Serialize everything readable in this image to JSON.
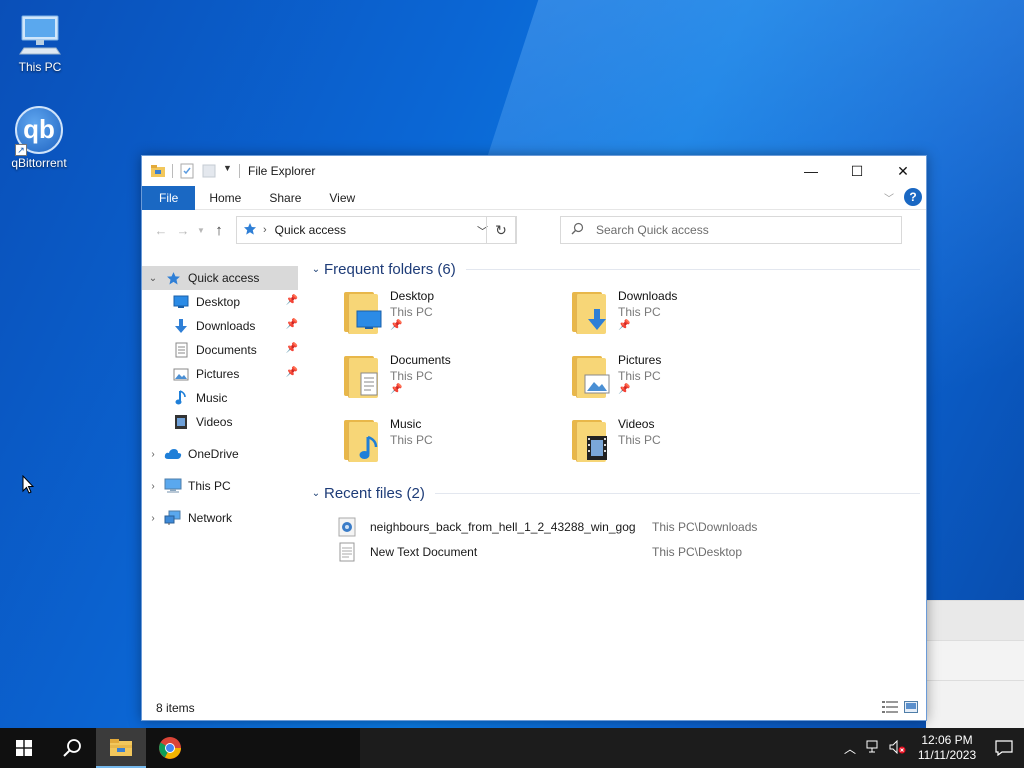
{
  "desktop": {
    "icons": [
      {
        "label": "This PC"
      },
      {
        "label": "qBittorrent",
        "glyph": "qb"
      }
    ]
  },
  "window": {
    "title": "File Explorer",
    "controls": {
      "minimize": "—",
      "maximize": "☐",
      "close": "✕"
    }
  },
  "ribbon": {
    "tabs": [
      "File",
      "Home",
      "Share",
      "View"
    ],
    "help": "?"
  },
  "address": {
    "path": "Quick access",
    "search_placeholder": "Search Quick access"
  },
  "nav": {
    "quick_access": "Quick access",
    "pinned": [
      {
        "label": "Desktop",
        "pinned": true
      },
      {
        "label": "Downloads",
        "pinned": true
      },
      {
        "label": "Documents",
        "pinned": true
      },
      {
        "label": "Pictures",
        "pinned": true
      },
      {
        "label": "Music",
        "pinned": false
      },
      {
        "label": "Videos",
        "pinned": false
      }
    ],
    "onedrive": "OneDrive",
    "thispc": "This PC",
    "network": "Network"
  },
  "content": {
    "frequent_header": "Frequent folders (6)",
    "folders": [
      {
        "name": "Desktop",
        "location": "This PC",
        "pinned": true,
        "icon": "desktop-icon"
      },
      {
        "name": "Downloads",
        "location": "This PC",
        "pinned": true,
        "icon": "downloads-icon"
      },
      {
        "name": "Documents",
        "location": "This PC",
        "pinned": true,
        "icon": "documents-icon"
      },
      {
        "name": "Pictures",
        "location": "This PC",
        "pinned": true,
        "icon": "pictures-icon"
      },
      {
        "name": "Music",
        "location": "This PC",
        "pinned": false,
        "icon": "music-icon"
      },
      {
        "name": "Videos",
        "location": "This PC",
        "pinned": false,
        "icon": "videos-icon"
      }
    ],
    "recent_header": "Recent files (2)",
    "recent": [
      {
        "name": "neighbours_back_from_hell_1_2_43288_win_gog",
        "path": "This PC\\Downloads",
        "icon": "installer-icon"
      },
      {
        "name": "New Text Document",
        "path": "This PC\\Desktop",
        "icon": "text-file-icon"
      }
    ]
  },
  "status": {
    "items": "8 items"
  },
  "taskbar": {
    "time": "12:06 PM",
    "date": "11/11/2023"
  },
  "colors": {
    "accent": "#1a68c3",
    "header_text": "#1e3c78",
    "folder": "#f7d677"
  }
}
